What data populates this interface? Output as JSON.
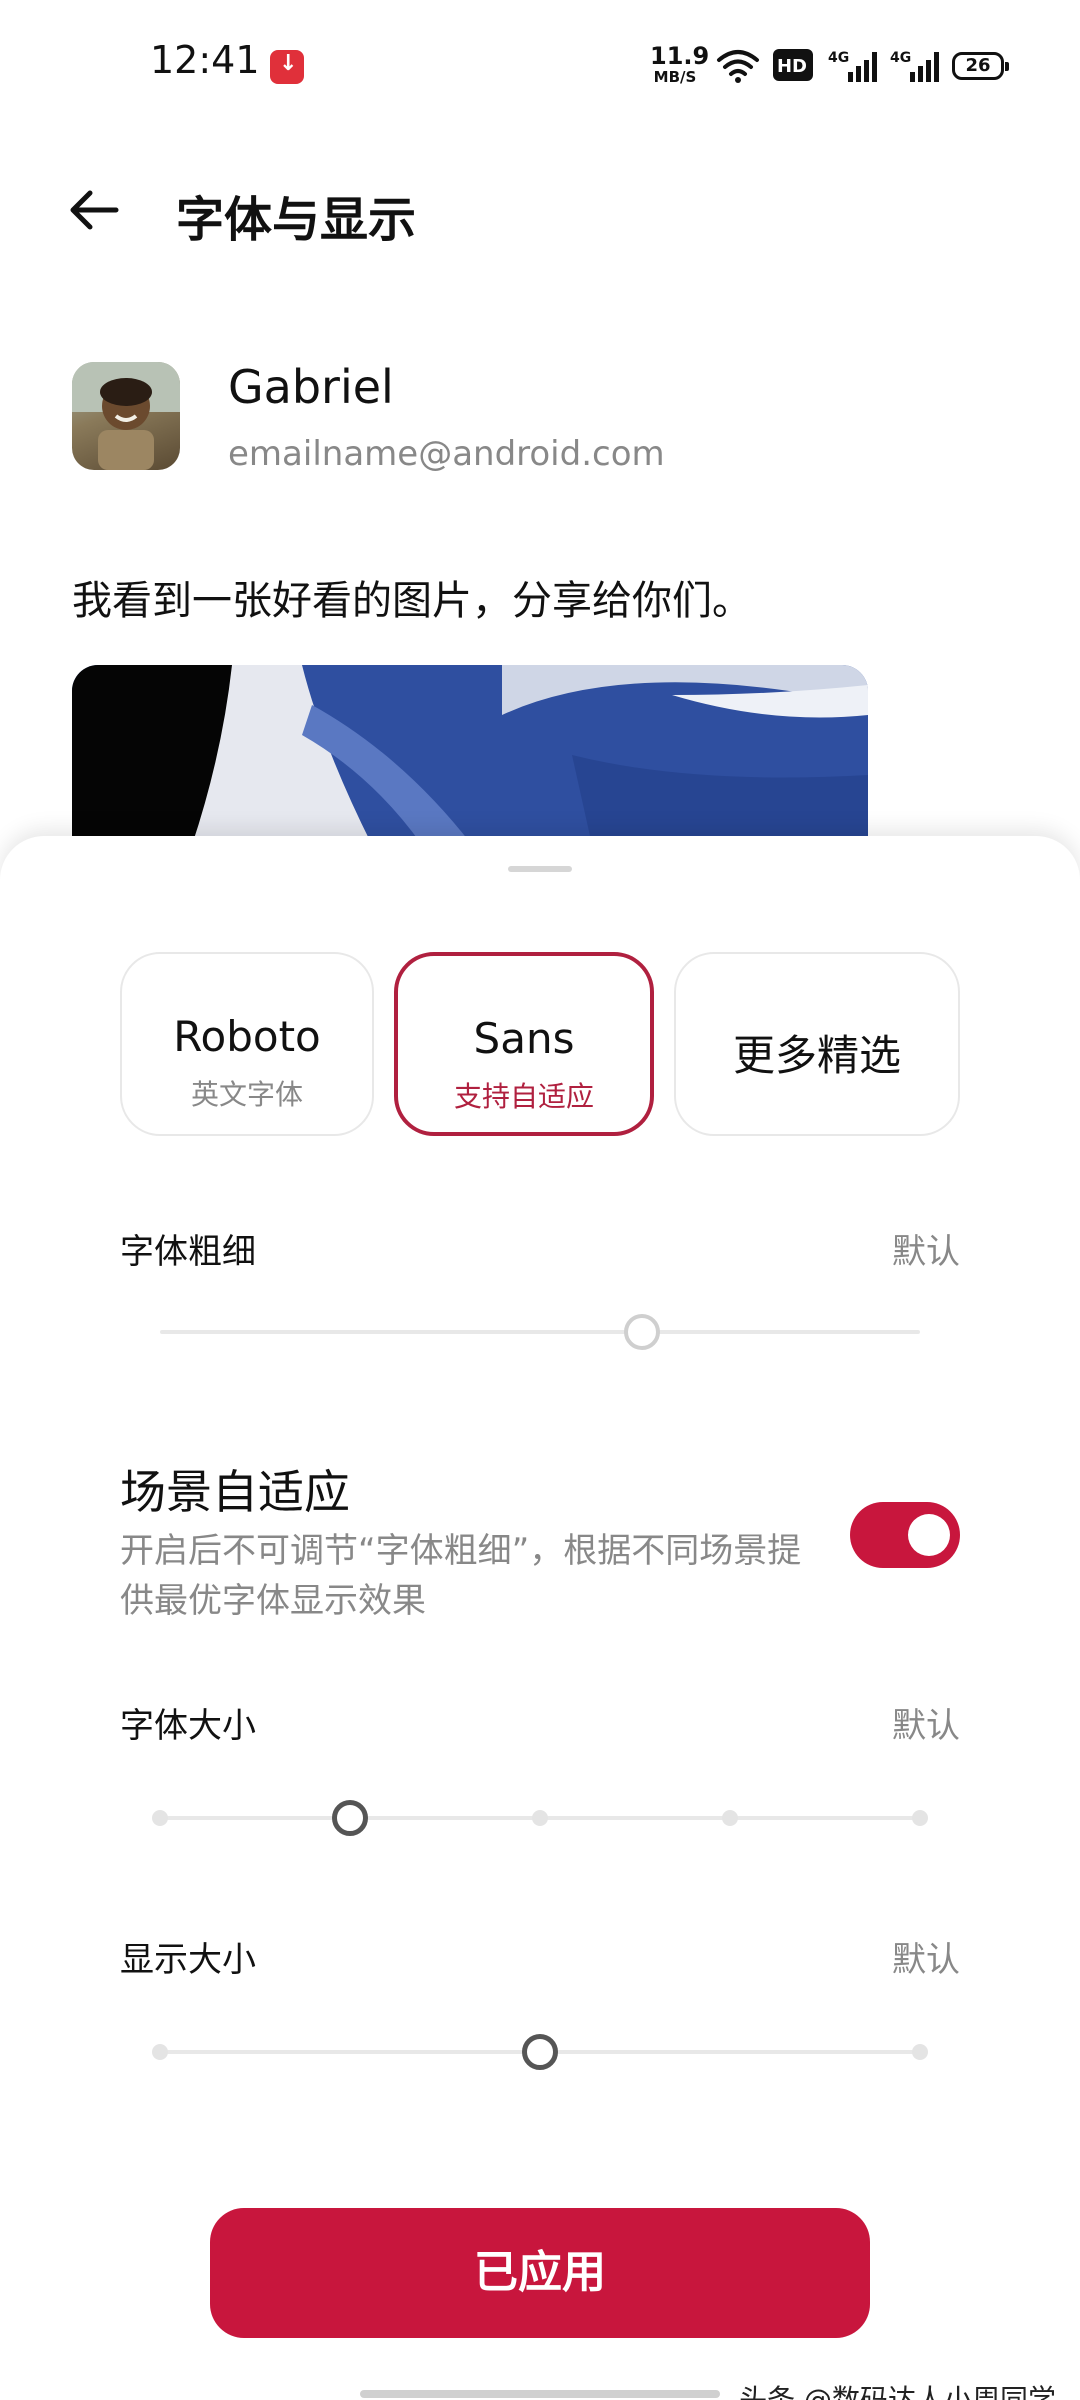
{
  "status_bar": {
    "time": "12:41",
    "net_speed_value": "11.9",
    "net_speed_unit": "MB/S",
    "battery": "26",
    "hd_label": "HD",
    "signal_1": "4G",
    "signal_2": "4G"
  },
  "header": {
    "title": "字体与显示"
  },
  "preview": {
    "name": "Gabriel",
    "email": "emailname@android.com",
    "message": "我看到一张好看的图片，分享给你们。"
  },
  "font_options": [
    {
      "name": "Roboto",
      "subtitle": "英文字体",
      "selected": false
    },
    {
      "name": "Sans",
      "subtitle": "支持自适应",
      "selected": true
    },
    {
      "name": "更多精选",
      "subtitle": "",
      "selected": false
    }
  ],
  "font_weight": {
    "label": "字体粗细",
    "value": "默认",
    "level_fraction": 0.5
  },
  "scene_adaptive": {
    "title": "场景自适应",
    "description": "开启后不可调节“字体粗细”，根据不同场景提供最优字体显示效果",
    "enabled": true
  },
  "font_size": {
    "label": "字体大小",
    "value": "默认",
    "step": 1,
    "steps_total": 5
  },
  "display_size": {
    "label": "显示大小",
    "value": "默认",
    "step": 2,
    "steps_total": 5
  },
  "apply_button": {
    "label": "已应用"
  },
  "watermark": "头条 @数码达人小周同学",
  "colors": {
    "accent": "#c8163d",
    "selected_border": "#b0203f",
    "secondary_text": "#888888"
  }
}
